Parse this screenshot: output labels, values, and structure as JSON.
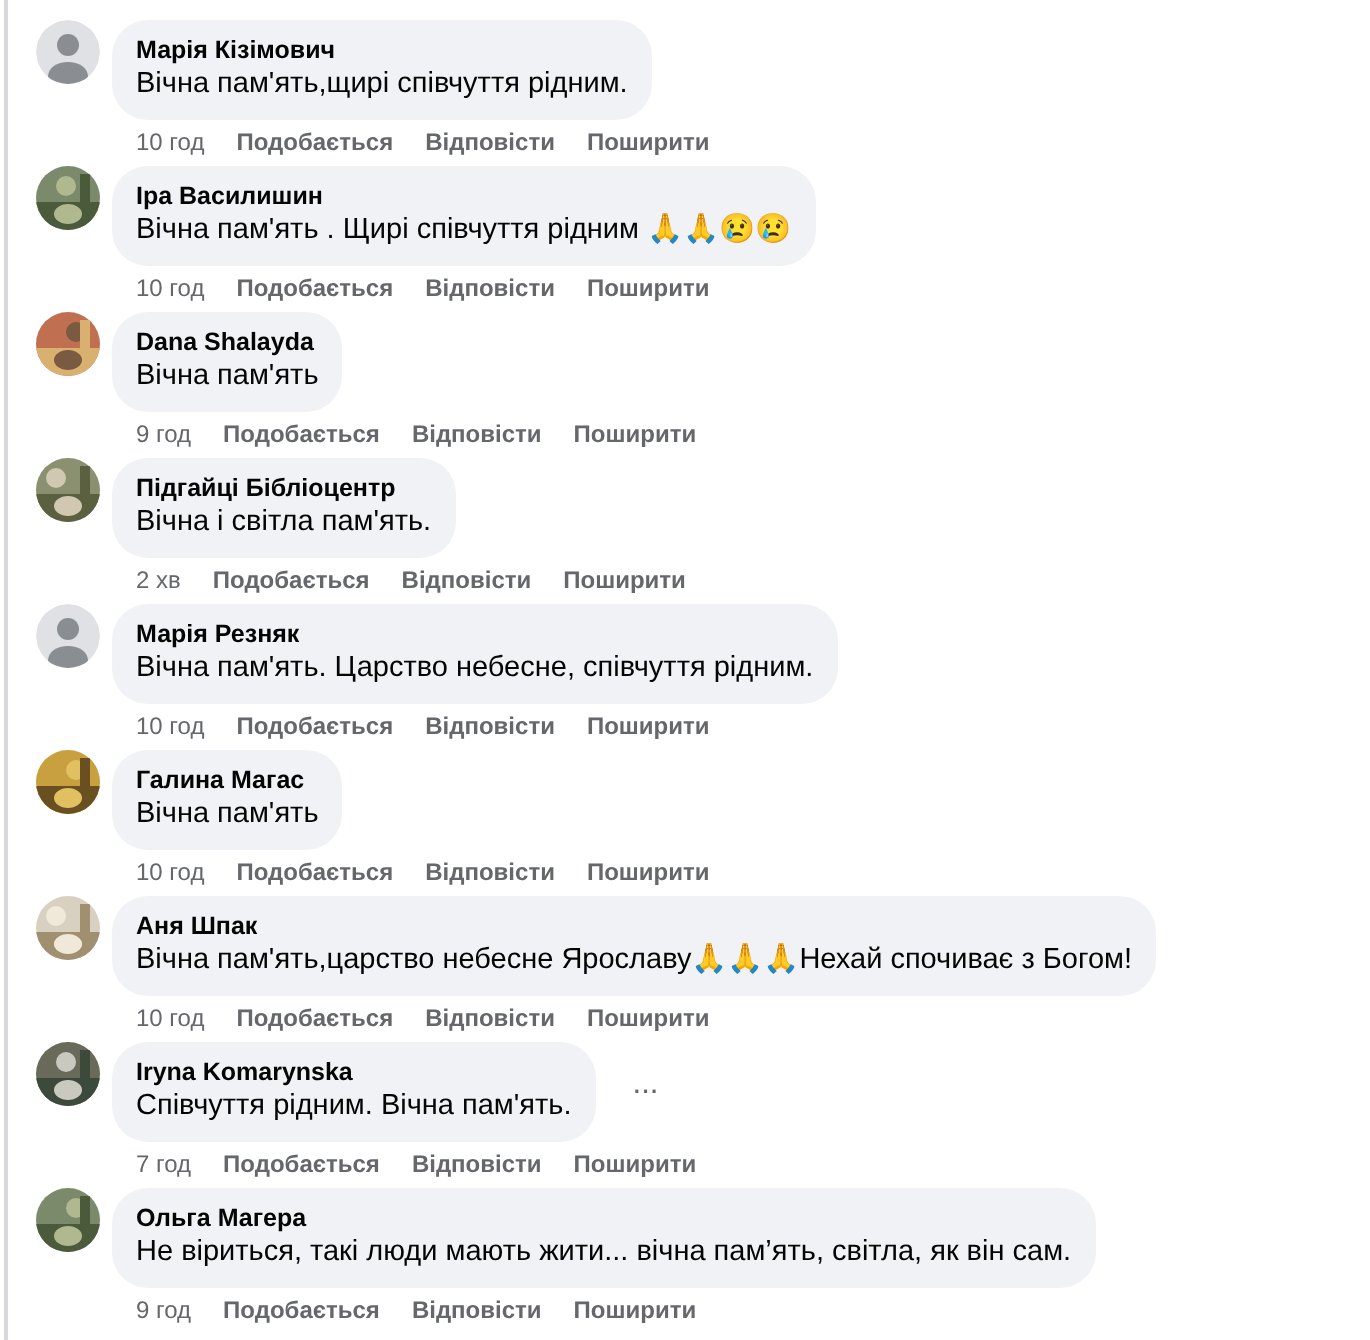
{
  "comments": [
    {
      "author": "Марія Кізімович",
      "avatar": {
        "kind": "silhouette"
      },
      "text": "Вічна пам'ять,щирі співчуття рідним.",
      "time": "10 год",
      "actions": [
        "Подобається",
        "Відповісти",
        "Поширити"
      ]
    },
    {
      "author": "Іра Василишин",
      "text": "Вічна пам'ять . Щирі співчуття рідним 🙏🙏😢😢",
      "time": "10 год",
      "actions": [
        "Подобається",
        "Відповісти",
        "Поширити"
      ]
    },
    {
      "author": "Dana Shalayda",
      "text": "Вічна пам'ять",
      "time": "9 год",
      "actions": [
        "Подобається",
        "Відповісти",
        "Поширити"
      ]
    },
    {
      "author": "Підгайці Бібліоцентр",
      "text": "Вічна і світла пам'ять.",
      "time": "2 хв",
      "actions": [
        "Подобається",
        "Відповісти",
        "Поширити"
      ]
    },
    {
      "author": "Марія Резняк",
      "avatar": {
        "kind": "silhouette"
      },
      "text": "Вічна пам'ять. Царство небесне, співчуття рідним.",
      "time": "10 год",
      "actions": [
        "Подобається",
        "Відповісти",
        "Поширити"
      ]
    },
    {
      "author": "Галина Магас",
      "text": "Вічна пам'ять",
      "time": "10 год",
      "actions": [
        "Подобається",
        "Відповісти",
        "Поширити"
      ]
    },
    {
      "author": "Аня Шпак",
      "text": "Вічна пам'ять,царство небесне Ярославу🙏🙏🙏Нехай спочиває з Богом!",
      "time": "10 год",
      "actions": [
        "Подобається",
        "Відповісти",
        "Поширити"
      ]
    },
    {
      "author": "Iryna Komarynska",
      "text": "Співчуття рідним. Вічна пам'ять.",
      "time": "7 год",
      "actions": [
        "Подобається",
        "Відповісти",
        "Поширити"
      ],
      "more_button": "···"
    },
    {
      "author": "Ольга Магера",
      "text": "Не віриться, такі люди мають жити... вічна пам’ять, світла, як він сам.",
      "time": "9 год",
      "actions": [
        "Подобається",
        "Відповісти",
        "Поширити"
      ]
    }
  ]
}
